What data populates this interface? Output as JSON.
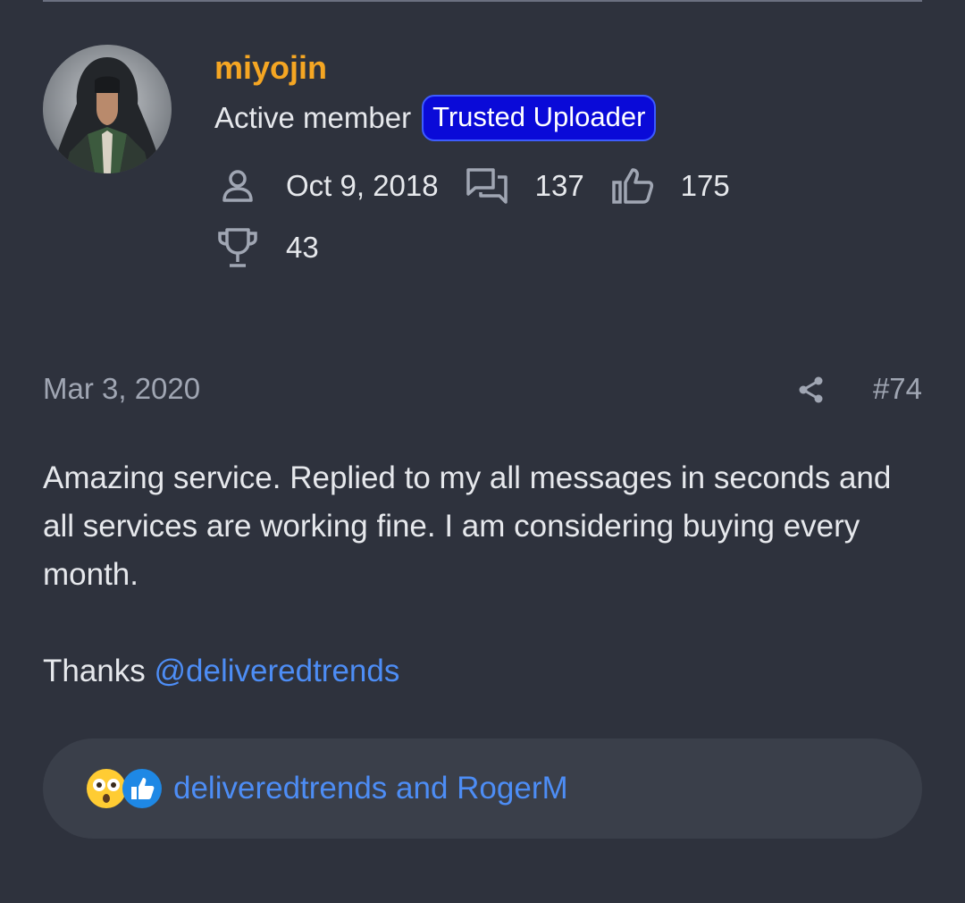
{
  "author": {
    "username": "miyojin",
    "user_title": "Active member",
    "banner": "Trusted Uploader",
    "joined": "Oct 9, 2018",
    "messages": "137",
    "reaction_score": "175",
    "points": "43"
  },
  "post": {
    "date": "Mar 3, 2020",
    "number": "#74",
    "body_line1": "Amazing service. Replied to my all messages in seconds and all services are working fine. I am considering buying every month.",
    "thanks_text": "Thanks ",
    "mention": "@deliveredtrends"
  },
  "reactions": {
    "users_text": "deliveredtrends and RogerM",
    "icons": [
      "wow-emoji-icon",
      "like-emoji-icon"
    ]
  },
  "colors": {
    "background": "#2e323d",
    "username": "#f5a623",
    "banner_bg": "#0a0ad8",
    "link": "#4d8df5",
    "muted": "#a0a6b3"
  }
}
